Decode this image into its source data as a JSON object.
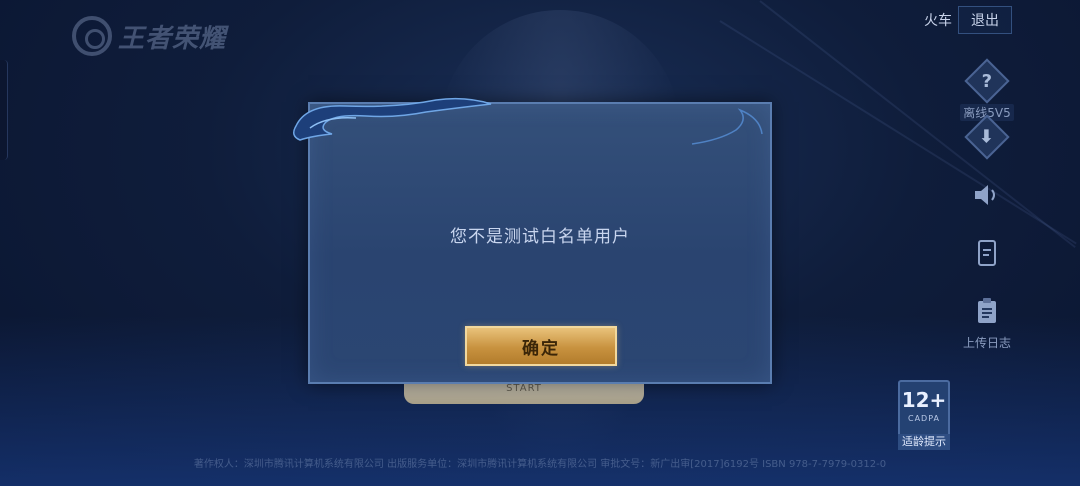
{
  "logo": {
    "text": "王者荣耀"
  },
  "top_right": {
    "train_label": "火车",
    "exit_label": "退出"
  },
  "side_menu": {
    "help_label": "离线5V5",
    "upload_log_label": "上传日志"
  },
  "dialog": {
    "message": "您不是测试白名单用户",
    "confirm_label": "确定"
  },
  "start_plate": {
    "label": "START"
  },
  "age_badge": {
    "rating": "12+",
    "org": "CADPA",
    "tip": "适龄提示"
  },
  "footer": {
    "text": "著作权人：深圳市腾讯计算机系统有限公司 出版服务单位：深圳市腾讯计算机系统有限公司 审批文号：新广出审[2017]6192号 ISBN 978-7-7979-0312-0"
  }
}
